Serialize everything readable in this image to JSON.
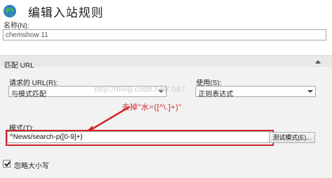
{
  "header": {
    "title": "编辑入站规则",
    "icon": "globe-icon"
  },
  "name_field": {
    "label": "名称(N):",
    "value": "chemshow 11"
  },
  "section": {
    "title": "匹配 URL"
  },
  "requested_url": {
    "label": "请求的 URL(R):",
    "value": "与模式匹配"
  },
  "using": {
    "label": "使用(S):",
    "value": "正则表达式"
  },
  "pattern": {
    "label": "模式(T):",
    "value": "^News/search-p([0-9]+)"
  },
  "test_button": {
    "label": "测试模式(E)..."
  },
  "annotation": {
    "text": "去掉\"水=([^\\.]+)\""
  },
  "watermark": {
    "text": "http://blog.csdn.net/           087"
  },
  "ignore_case": {
    "label": "忽略大小写",
    "checked": true
  },
  "colors": {
    "accent_red": "#d2232a",
    "section_bg": "#f2f2f2"
  }
}
